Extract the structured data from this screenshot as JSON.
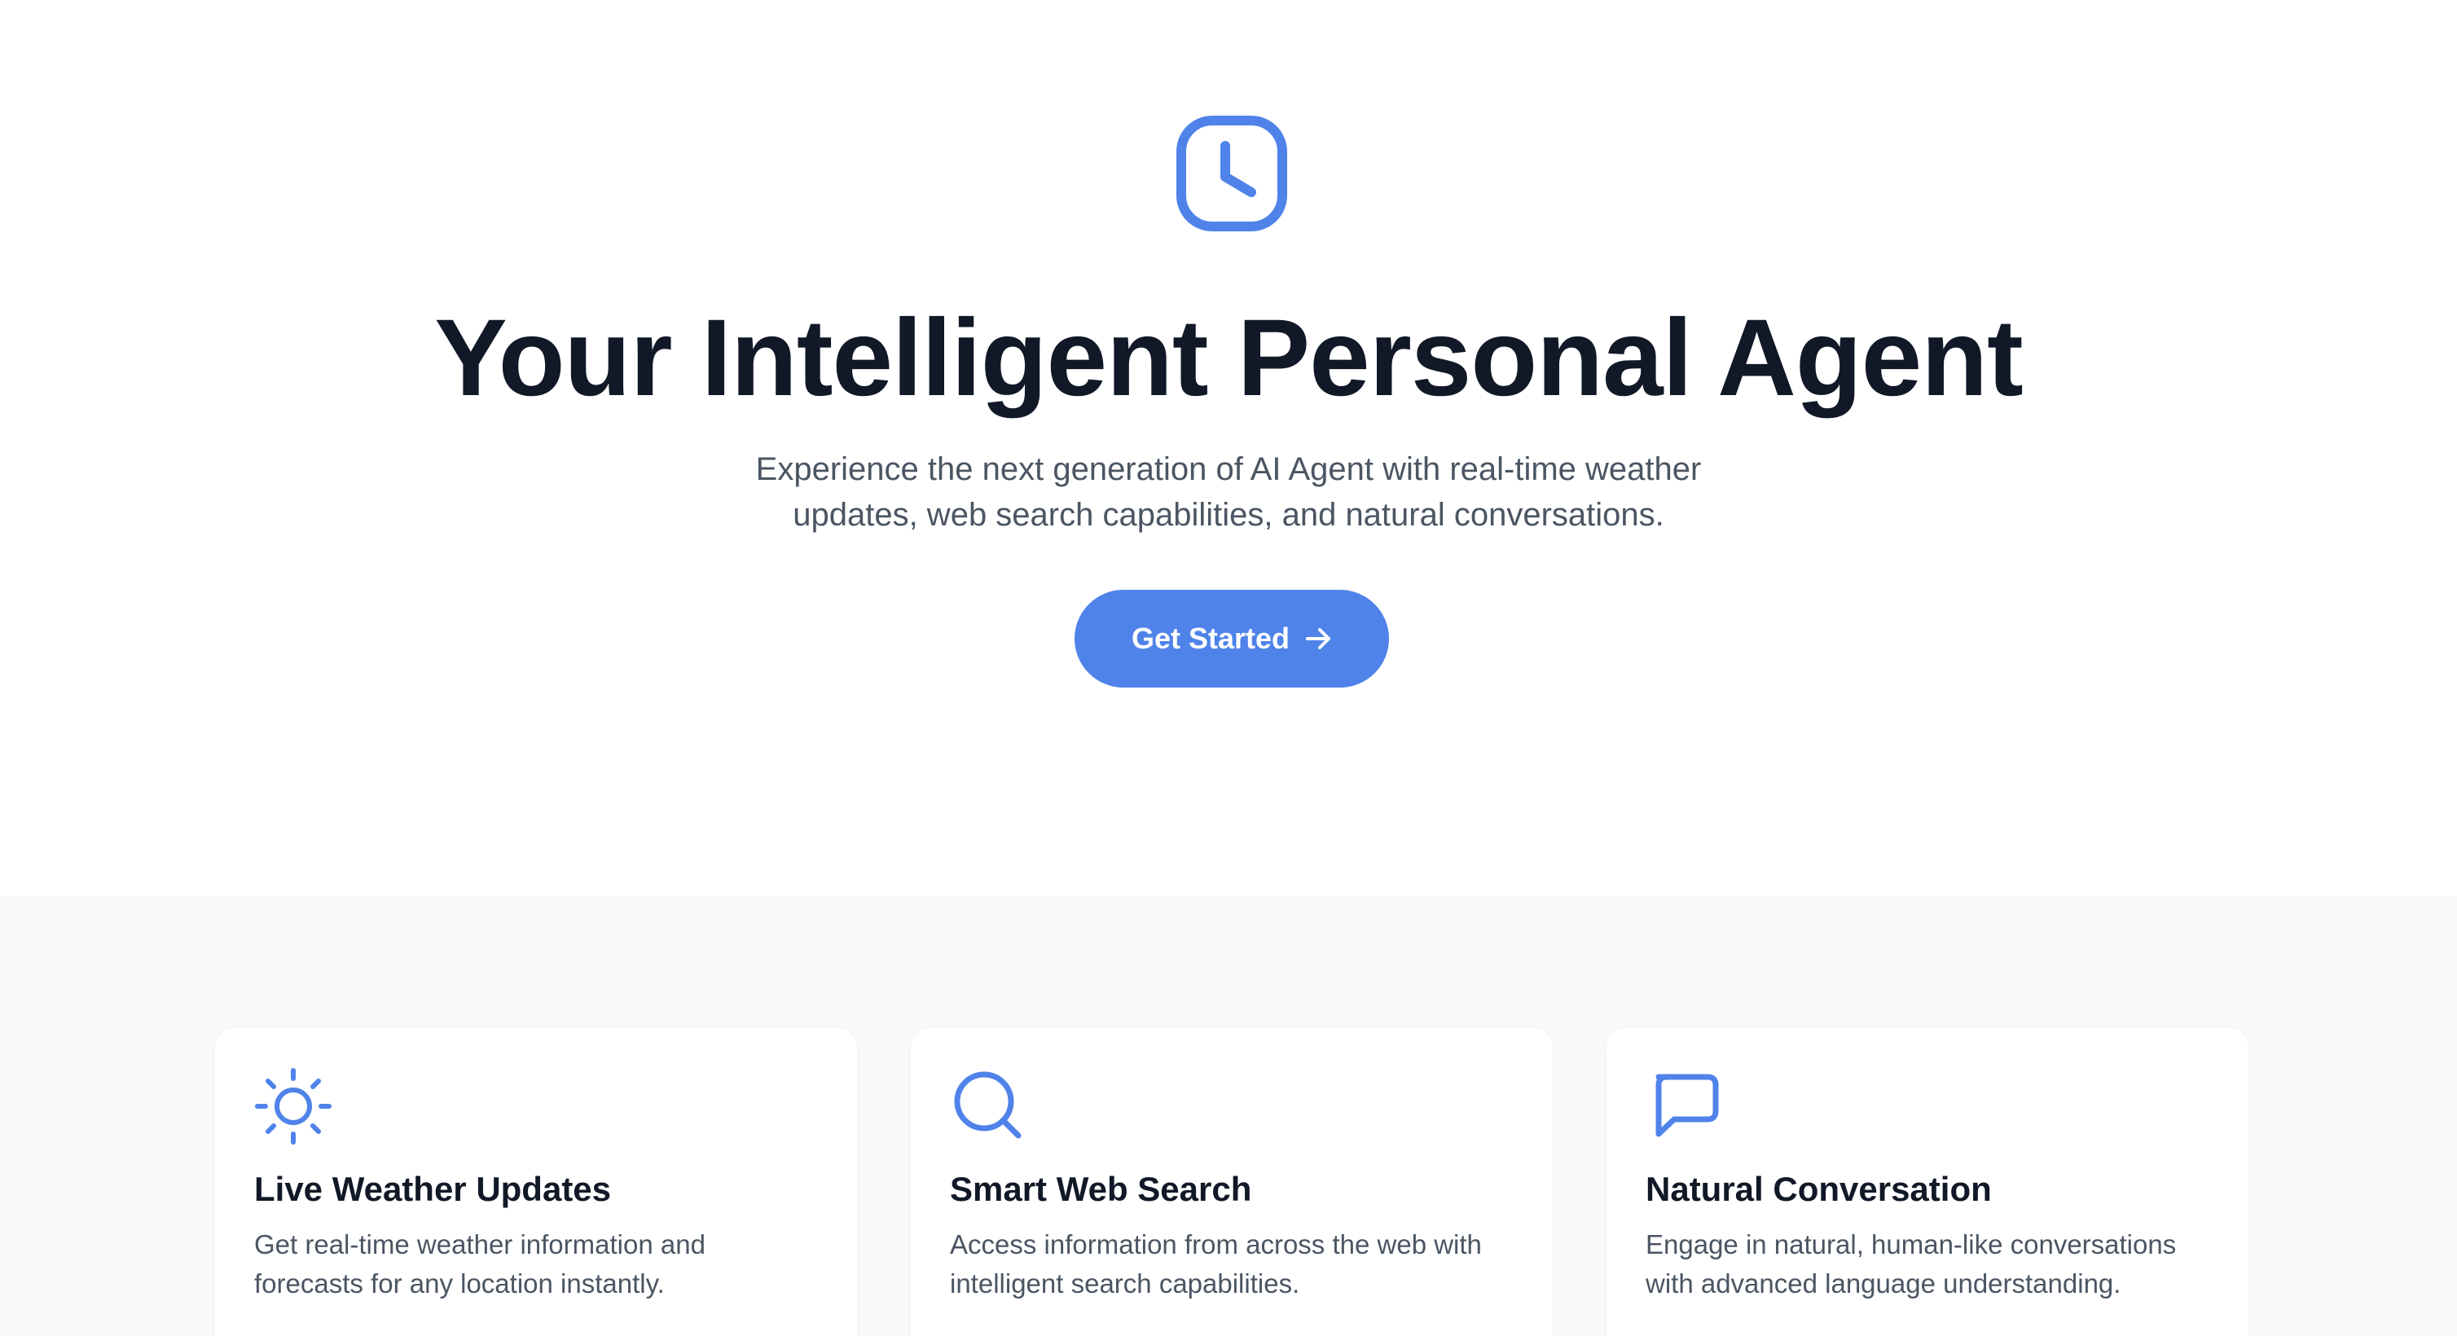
{
  "theme": {
    "accent": "#4f83ea",
    "heading": "#111827",
    "body_text": "#4b5563",
    "features_background": "#f8f9fb"
  },
  "hero": {
    "icon": "clock-icon",
    "title": "Your Intelligent Personal Agent",
    "subtitle": "Experience the next generation of AI Agent with real-time weather updates, web search capabilities, and natural conversations.",
    "cta_label": "Get Started",
    "cta_icon": "arrow-right-icon"
  },
  "features": [
    {
      "icon": "sun-icon",
      "title": "Live Weather Updates",
      "description": "Get real-time weather information and forecasts for any location instantly."
    },
    {
      "icon": "search-icon",
      "title": "Smart Web Search",
      "description": "Access information from across the web with intelligent search capabilities."
    },
    {
      "icon": "message-icon",
      "title": "Natural Conversation",
      "description": "Engage in natural, human-like conversations with advanced language understanding."
    }
  ]
}
